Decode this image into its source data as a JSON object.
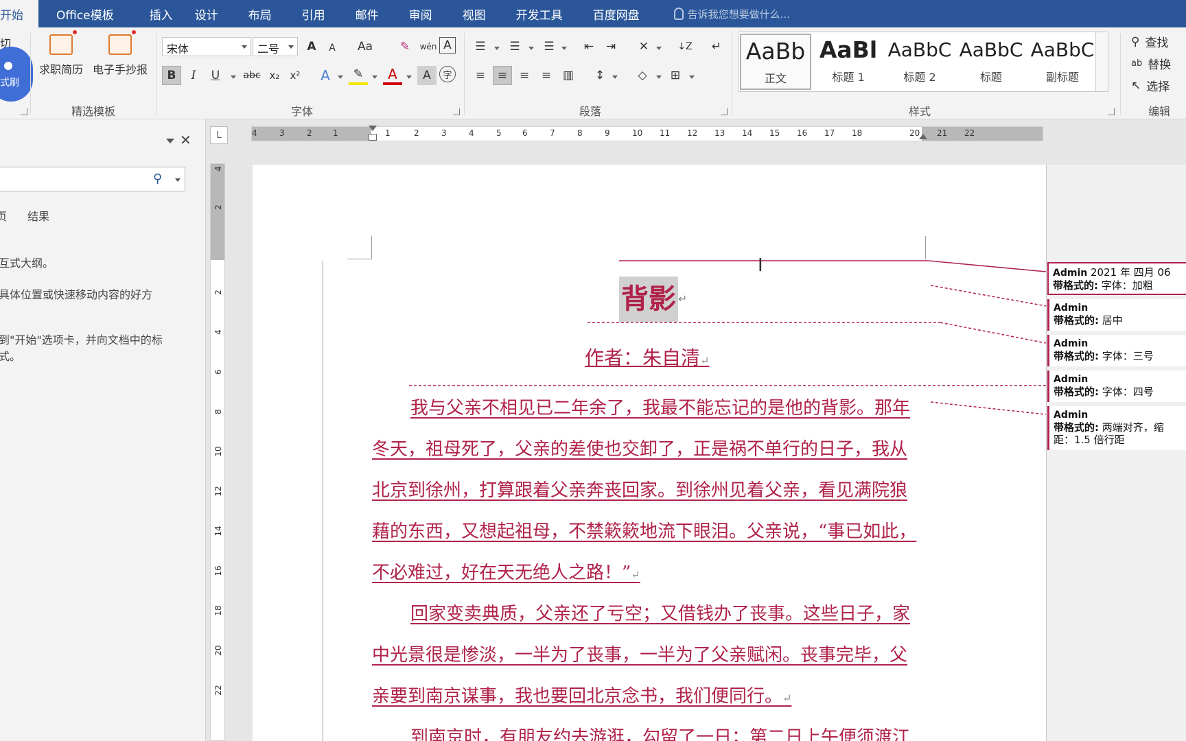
{
  "tabs": {
    "home": "开始",
    "office_templates": "Office模板",
    "insert": "插入",
    "design": "设计",
    "layout": "布局",
    "references": "引用",
    "mailings": "邮件",
    "review": "审阅",
    "view": "视图",
    "developer": "开发工具",
    "baidu": "百度网盘",
    "tell_me": "告诉我您想要做什么..."
  },
  "ribbon": {
    "clipboard": {
      "cut": "切",
      "format_painter": "式刷"
    },
    "templates": {
      "resume": "求职简历",
      "handwritten": "电子手抄报",
      "group": "精选模板"
    },
    "font": {
      "name": "宋体",
      "size": "二号",
      "group": "字体",
      "bold": "B",
      "italic": "I",
      "underline": "U",
      "strike": "abc",
      "subscript": "x₂",
      "superscript": "x²",
      "grow": "A",
      "shrink": "A",
      "case": "Aa"
    },
    "paragraph": {
      "group": "段落"
    },
    "styles": {
      "group": "样式",
      "items": [
        {
          "sample": "AaBb",
          "name": "正文"
        },
        {
          "sample": "AaBl",
          "name": "标题 1"
        },
        {
          "sample": "AaBbC",
          "name": "标题 2"
        },
        {
          "sample": "AaBbC",
          "name": "标题"
        },
        {
          "sample": "AaBbC",
          "name": "副标题"
        }
      ]
    },
    "editing": {
      "find": "查找",
      "replace": "替换",
      "select": "选择",
      "group": "编辑"
    }
  },
  "nav": {
    "tab_results": "结果",
    "tab_pages": "页",
    "lines": [
      "互式大纲。",
      "具体位置或快速移动内容的好方",
      "到\"开始\"选项卡，并向文档中的标",
      "式。"
    ]
  },
  "ruler": {
    "h": [
      "4",
      "3",
      "2",
      "1",
      "1",
      "2",
      "3",
      "4",
      "5",
      "6",
      "7",
      "8",
      "9",
      "10",
      "11",
      "12",
      "13",
      "14",
      "15",
      "16",
      "17",
      "18",
      "20",
      "21",
      "22"
    ],
    "v": [
      "4",
      "2",
      "2",
      "4",
      "6",
      "8",
      "10",
      "12",
      "14",
      "16",
      "18",
      "20",
      "22"
    ],
    "corner": "L"
  },
  "document": {
    "title": "背影",
    "author": "作者：朱自清",
    "lines": [
      "我与父亲不相见已二年余了，我最不能忘记的是他的背影。那年",
      "冬天，祖母死了，父亲的差使也交卸了，正是祸不单行的日子，我从",
      "北京到徐州，打算跟着父亲奔丧回家。到徐州见着父亲，看见满院狼",
      "藉的东西，又想起祖母，不禁簌簌地流下眼泪。父亲说，“事已如此，",
      "不必难过，好在天无绝人之路！”",
      "回家变卖典质，父亲还了亏空；又借钱办了丧事。这些日子，家",
      "中光景很是惨淡，一半为了丧事，一半为了父亲赋闲。丧事完毕，父",
      "亲要到南京谋事，我也要回北京念书，我们便同行。",
      "到南京时，有朋友约去游逛，勾留了一日；第二日上午便须渡江"
    ],
    "para_mark": "↵"
  },
  "comments": [
    {
      "author": "Admin",
      "date": "2021 年 四月 06",
      "label": "带格式的",
      "text": "字体：加粗"
    },
    {
      "author": "Admin",
      "label": "带格式的",
      "text": "居中"
    },
    {
      "author": "Admin",
      "label": "带格式的",
      "text": "字体：三号"
    },
    {
      "author": "Admin",
      "label": "带格式的",
      "text": "字体：四号"
    },
    {
      "author": "Admin",
      "label": "带格式的",
      "text": "两端对齐，缩",
      "extra": "距：1.5 倍行距"
    }
  ],
  "colors": {
    "tabbar": "#2b579a",
    "revision": "#b0224a"
  }
}
